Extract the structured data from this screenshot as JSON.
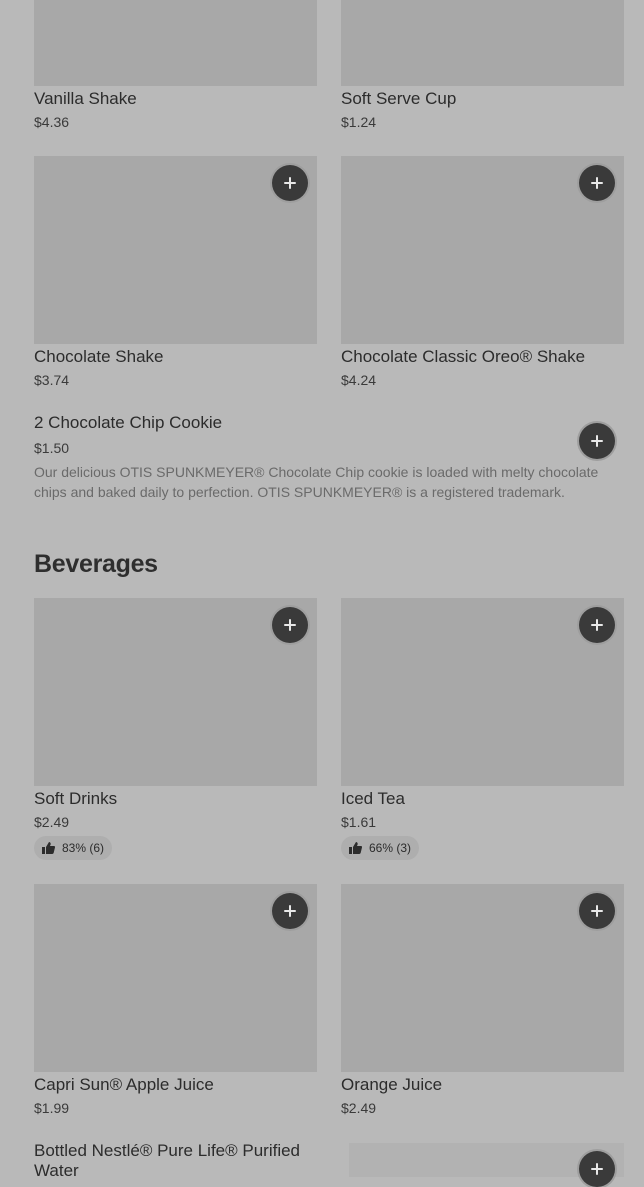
{
  "items_top": [
    {
      "name": "Vanilla Shake",
      "price": "$4.36"
    },
    {
      "name": "Soft Serve Cup",
      "price": "$1.24"
    },
    {
      "name": "Chocolate Shake",
      "price": "$3.74"
    },
    {
      "name": "Chocolate Classic Oreo® Shake",
      "price": "$4.24"
    }
  ],
  "cookie": {
    "name": "2 Chocolate Chip Cookie",
    "price": "$1.50",
    "description": "Our delicious OTIS SPUNKMEYER® Chocolate Chip cookie is loaded with melty chocolate chips and baked daily to perfection. OTIS SPUNKMEYER® is a registered trademark."
  },
  "beverages": {
    "title": "Beverages",
    "items": [
      {
        "name": "Soft Drinks",
        "price": "$2.49",
        "rating": "83% (6)"
      },
      {
        "name": "Iced Tea",
        "price": "$1.61",
        "rating": "66% (3)"
      },
      {
        "name": "Capri Sun® Apple Juice",
        "price": "$1.99"
      },
      {
        "name": "Orange Juice",
        "price": "$2.49"
      },
      {
        "name": "Bottled Nestlé® Pure Life® Purified Water"
      }
    ]
  },
  "colors": {
    "overlay": "#b9b9b9",
    "image_placeholder": "#a8a8a8",
    "button": "#3a3a3a"
  },
  "icons": {
    "add": "plus-icon",
    "rating": "thumbs-up-icon"
  }
}
